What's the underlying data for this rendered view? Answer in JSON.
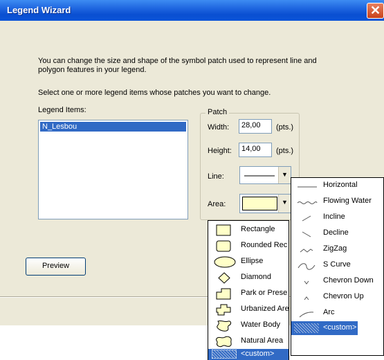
{
  "window": {
    "title": "Legend Wizard",
    "close_glyph": "✕",
    "description_1": "You can change the size and shape of the symbol patch used to represent line and polygon features in your legend.",
    "description_2": "Select one or more legend items whose patches you want to change.",
    "legend_items_label": "Legend Items:",
    "legend_items": [
      "N_Lesbou"
    ],
    "preview_button": "Preview"
  },
  "patch": {
    "group_label": "Patch",
    "width_label": "Width:",
    "width_value": "28,00",
    "width_unit": "(pts.)",
    "height_label": "Height:",
    "height_value": "14,00",
    "height_unit": "(pts.)",
    "line_label": "Line:",
    "area_label": "Area:"
  },
  "area_dropdown": {
    "items": [
      "Rectangle",
      "Rounded Rec",
      "Ellipse",
      "Diamond",
      "Park or Prese",
      "Urbanized Are",
      "Water Body",
      "Natural Area",
      "<custom>"
    ],
    "selected": "<custom>"
  },
  "line_dropdown": {
    "items": [
      "Horizontal",
      "Flowing Water",
      "Incline",
      "Decline",
      "ZigZag",
      "S Curve",
      "Chevron Down",
      "Chevron Up",
      "Arc",
      "<custom>"
    ],
    "selected": "<custom>"
  },
  "colors": {
    "title_bar": "#0a4fd1",
    "selection": "#316ac5",
    "area_fill": "#ffffc8",
    "dialog_bg": "#ece9d8"
  }
}
